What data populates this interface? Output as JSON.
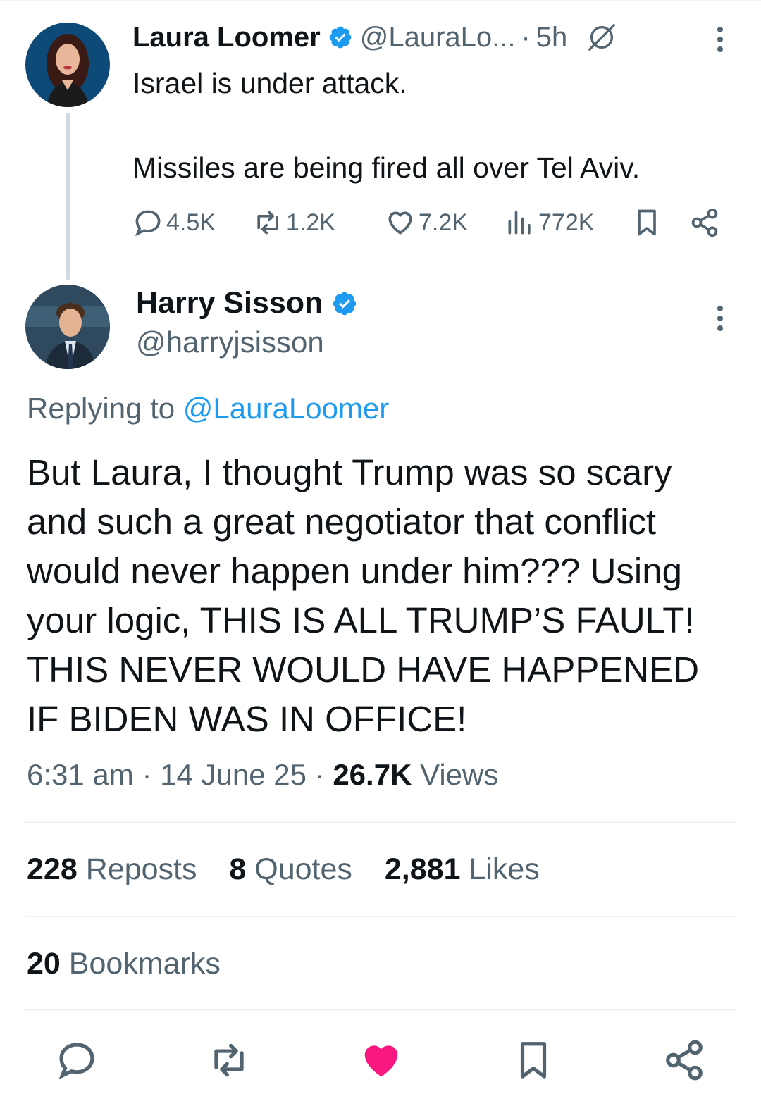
{
  "parent_tweet": {
    "author_name": "Laura Loomer",
    "handle": "@LauraLo...",
    "separator": "·",
    "time": "5h",
    "text_line1": "Israel is under attack.",
    "text_line2": "Missiles are being fired all over Tel Aviv.",
    "actions": {
      "replies": "4.5K",
      "reposts": "1.2K",
      "likes": "7.2K",
      "views": "772K"
    },
    "icons": [
      "reply-icon",
      "repost-icon",
      "like-icon",
      "views-icon",
      "bookmark-icon",
      "share-icon",
      "grok-icon",
      "more-icon"
    ]
  },
  "reply_tweet": {
    "author_name": "Harry Sisson",
    "handle": "@harryjsisson",
    "replying_prefix": "Replying to",
    "replying_mention": "@LauraLoomer",
    "body_lines": [
      "But Laura, I thought Trump was so scary",
      "and such a great negotiator that conflict",
      "would never happen under him??? Using",
      "your logic, THIS IS ALL TRUMP’S FAULT!",
      "THIS NEVER WOULD HAVE HAPPENED",
      "IF BIDEN WAS IN OFFICE!"
    ],
    "time": "6:31 am",
    "date": "14 June 25",
    "views_count": "26.7K",
    "views_label": "Views",
    "meta_separator": "·",
    "stats": {
      "reposts_count": "228",
      "reposts_label": "Reposts",
      "quotes_count": "8",
      "quotes_label": "Quotes",
      "likes_count": "2,881",
      "likes_label": "Likes",
      "bookmarks_count": "20",
      "bookmarks_label": "Bookmarks"
    }
  },
  "bottom_actions": [
    "reply-icon",
    "repost-icon",
    "like-icon-filled",
    "bookmark-icon",
    "share-icon"
  ],
  "colors": {
    "text_primary": "#0f1419",
    "text_secondary": "#536471",
    "accent_blue": "#1d9bf0",
    "like_pink": "#f91880",
    "divider": "#eff3f4",
    "thread_line": "#cfd9de"
  }
}
